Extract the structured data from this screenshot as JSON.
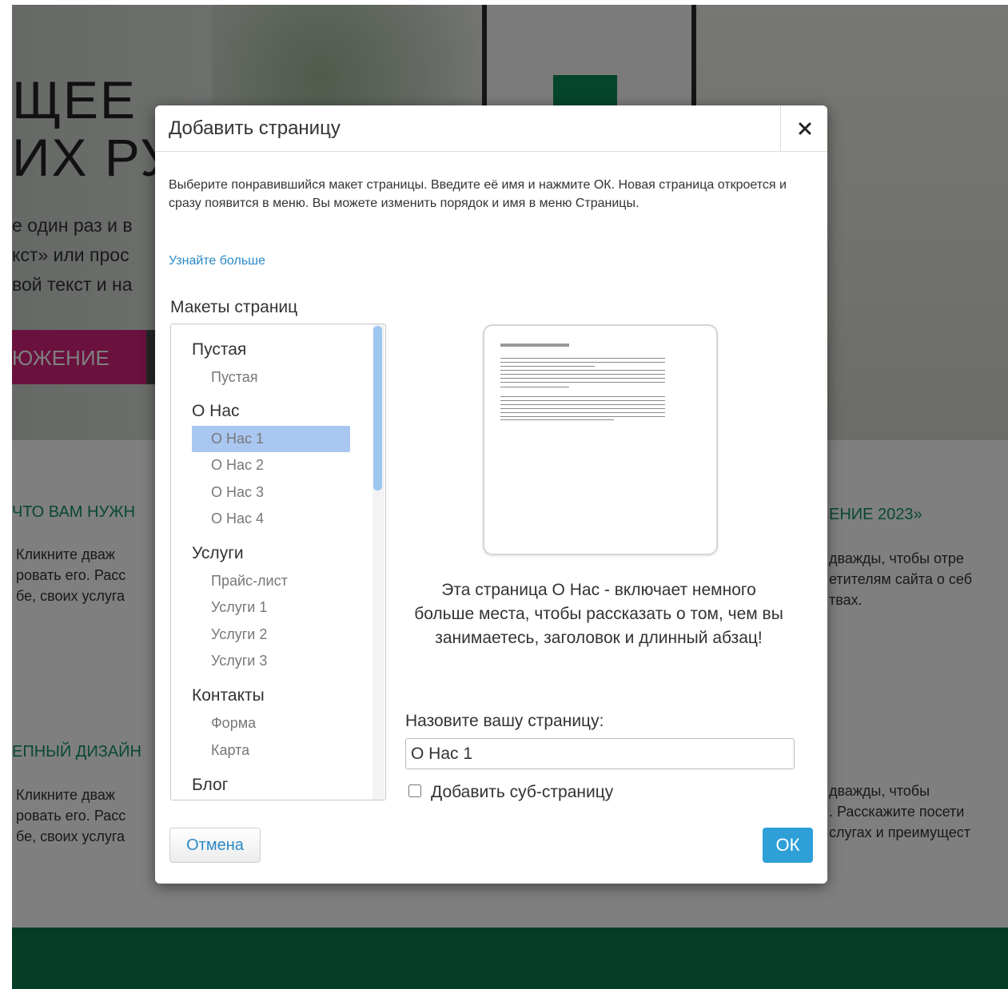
{
  "background_page": {
    "hero_title_line1": "ЩЕЕ",
    "hero_title_line2": "ИХ РУ",
    "hero_text_lines": [
      "е один раз и в",
      "кст» или прос",
      "вой текст и на"
    ],
    "hero_button_label": "ЮЖЕНИЕ",
    "section1_heading_left": "ЧТО ВАМ НУЖН",
    "section1_text_left": [
      "Кликните дваж",
      "ровать его. Расс",
      "бе, своих услуга"
    ],
    "section1_heading_right": "ЕНИЕ 2023»",
    "section1_text_right": [
      "дважды, чтобы отре",
      "етителям сайта о себ",
      "твах."
    ],
    "section2_heading_left": "ЕПНЫЙ ДИЗАЙН",
    "section2_text_left": [
      "Кликните дваж",
      "ровать его. Расс",
      "бе, своих услуга"
    ],
    "section2_text_right": [
      "дважды, чтобы",
      ". Расскажите посети",
      "слугах и преимущест"
    ],
    "footer_color": "#0b7d4c",
    "accent_pink": "#d5237a"
  },
  "dialog": {
    "title": "Добавить страницу",
    "close_icon": "close-icon",
    "description": "Выберите понравившийся макет страницы. Введите её имя и нажмите ОК. Новая страница откроется и сразу появится в меню. Вы можете изменить порядок и имя в меню Страницы.",
    "learn_more": "Узнайте больше",
    "layouts_title": "Макеты страниц",
    "groups": [
      {
        "title": "Пустая",
        "items": [
          "Пустая"
        ]
      },
      {
        "title": "О Нас",
        "items": [
          "О Нас 1",
          "О Нас 2",
          "О Нас 3",
          "О Нас 4"
        ]
      },
      {
        "title": "Услуги",
        "items": [
          "Прайс-лист",
          "Услуги 1",
          "Услуги 2",
          "Услуги 3"
        ]
      },
      {
        "title": "Контакты",
        "items": [
          "Форма",
          "Карта"
        ]
      },
      {
        "title": "Блог",
        "items": []
      }
    ],
    "selected_item": "О Нас 1",
    "preview_description": "Эта страница О Нас - включает немного больше места, чтобы рассказать о том, чем вы занимаетесь, заголовок и длинный абзац!",
    "name_label": "Назовите вашу страницу:",
    "name_value": "О Нас 1",
    "subpage_label": "Добавить суб-страницу",
    "subpage_checked": false,
    "cancel_label": "Отмена",
    "ok_label": "ОК",
    "link_color": "#2a8ac7",
    "ok_color": "#2f9fd8",
    "selection_color": "#aac7f2"
  }
}
